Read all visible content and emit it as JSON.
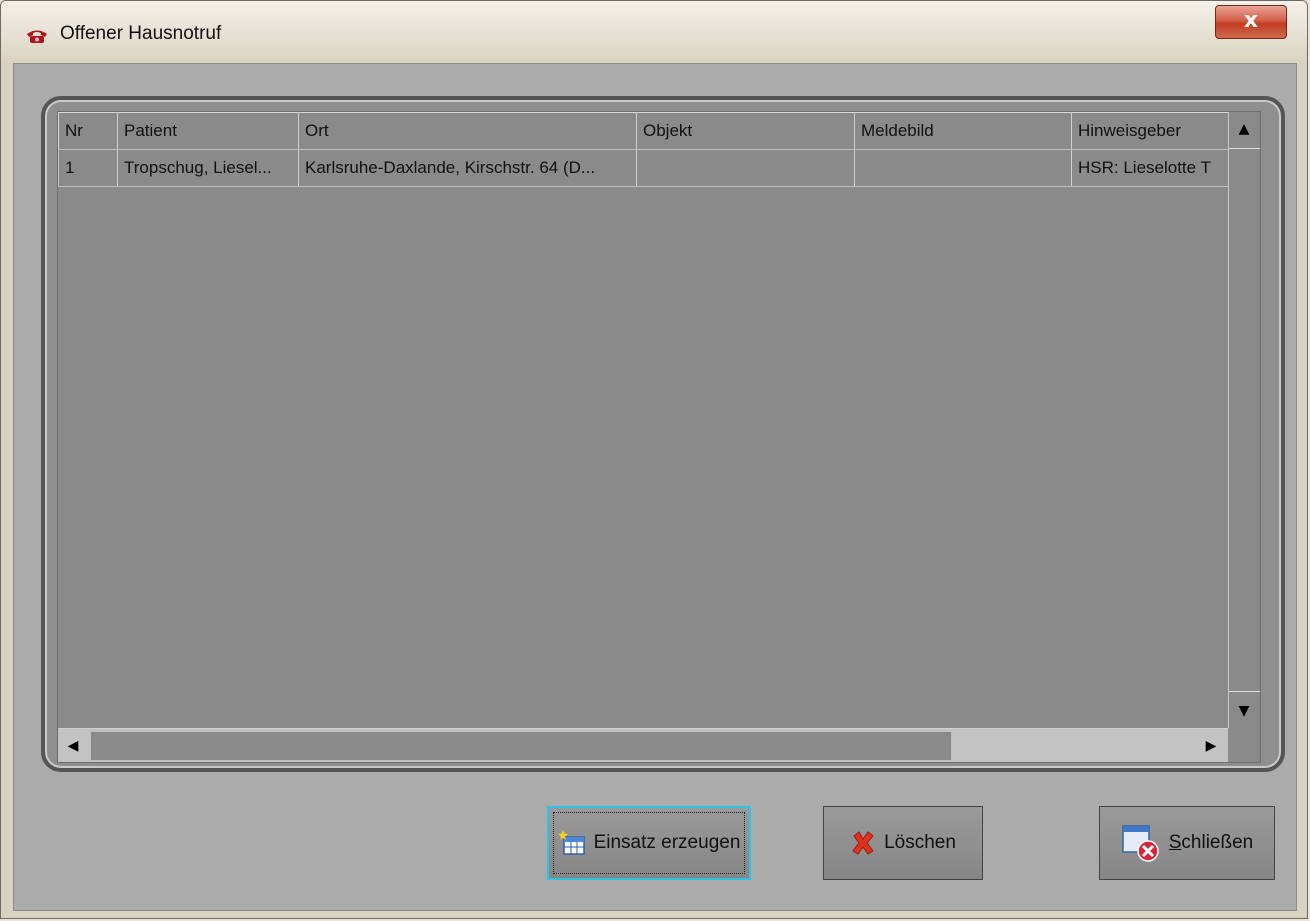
{
  "window": {
    "title": "Offener Hausnotruf",
    "close_glyph": "x"
  },
  "table": {
    "columns": [
      "Nr",
      "Patient",
      "Ort",
      "Objekt",
      "Meldebild",
      "Hinweisgeber"
    ],
    "rows": [
      [
        "1",
        "Tropschug, Liesel...",
        "Karlsruhe-Daxlande, Kirschstr. 64 (D...",
        "",
        "",
        "HSR: Lieselotte T"
      ]
    ]
  },
  "buttons": {
    "einsatz": "Einsatz erzeugen",
    "loeschen": "Löschen",
    "schliessen_mnemonic": "S",
    "schliessen_rest": "chließen"
  },
  "icons": {
    "app": "telephone-icon",
    "einsatz": "new-table-icon",
    "loeschen": "red-x-icon",
    "schliessen": "window-close-icon"
  },
  "colors": {
    "accent_focus": "#2ec4e8",
    "close_button": "#c23c22",
    "delete_red": "#e0301e"
  }
}
